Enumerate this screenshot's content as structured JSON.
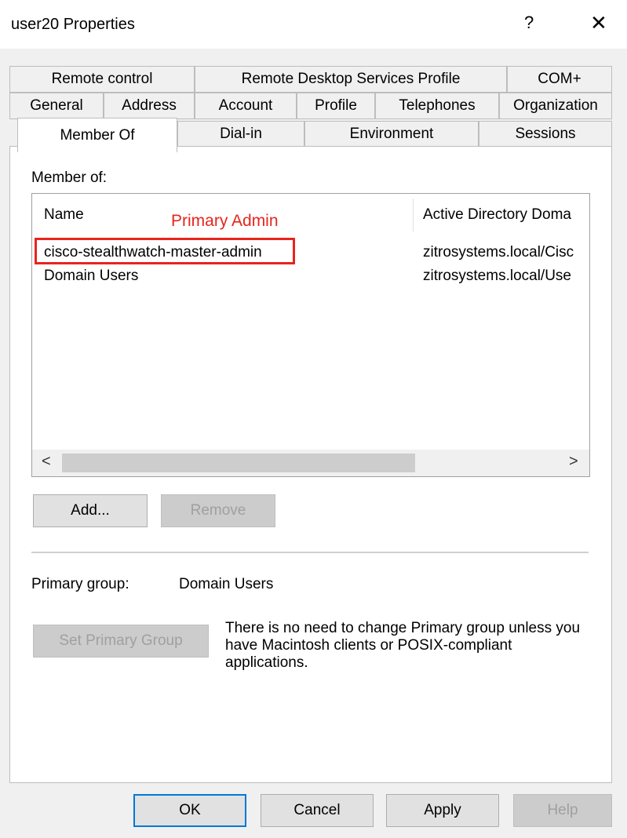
{
  "window": {
    "title": "user20 Properties",
    "help_glyph": "?",
    "close_glyph": "✕"
  },
  "tabs": {
    "row1": [
      "Remote control",
      "Remote Desktop Services Profile",
      "COM+"
    ],
    "row2": [
      "General",
      "Address",
      "Account",
      "Profile",
      "Telephones",
      "Organization"
    ],
    "row3": [
      "Member Of",
      "Dial-in",
      "Environment",
      "Sessions"
    ],
    "active": "Member Of"
  },
  "member_of": {
    "label": "Member of:",
    "columns": [
      "Name",
      "Active Directory Doma"
    ],
    "rows": [
      {
        "name": "cisco-stealthwatch-master-admin",
        "folder": "zitrosystems.local/Cisc"
      },
      {
        "name": "Domain Users",
        "folder": "zitrosystems.local/Use"
      }
    ],
    "annotation": "Primary Admin",
    "scroll_left": "<",
    "scroll_right": ">"
  },
  "buttons": {
    "add": "Add...",
    "remove": "Remove",
    "set_primary": "Set Primary Group"
  },
  "primary_group": {
    "label": "Primary group:",
    "value": "Domain Users",
    "note": "There is no need to change Primary group unless you have Macintosh clients or POSIX-compliant applications."
  },
  "footer": {
    "ok": "OK",
    "cancel": "Cancel",
    "apply": "Apply",
    "help": "Help"
  },
  "colors": {
    "annotation": "#e8241c",
    "default_button_border": "#0078d7"
  }
}
